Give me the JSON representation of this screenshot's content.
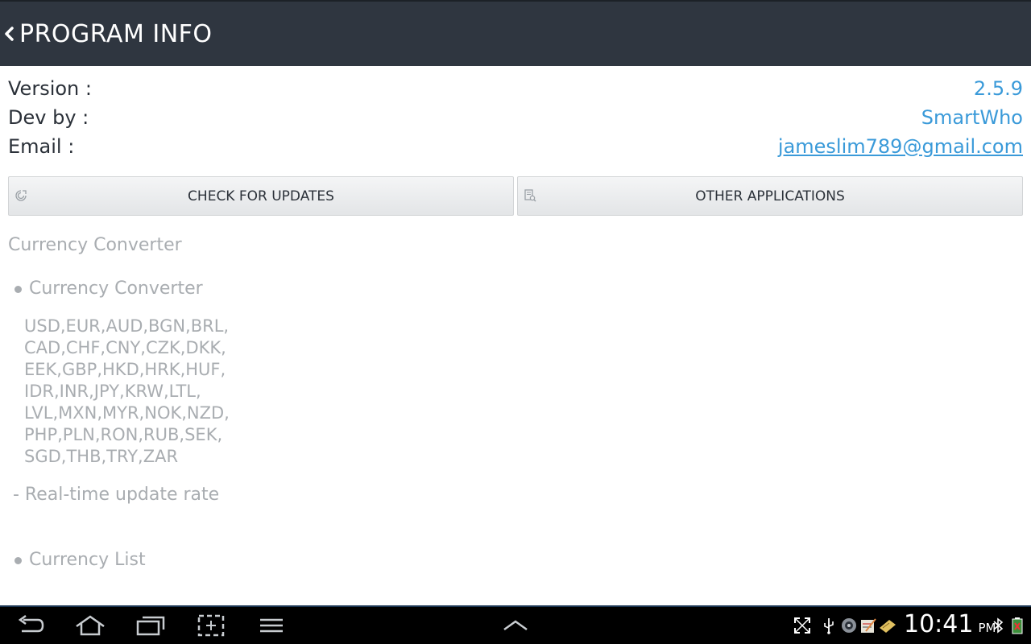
{
  "header": {
    "title": "PROGRAM INFO"
  },
  "info": {
    "version_label": "Version :",
    "version_value": "2.5.9",
    "dev_label": "Dev by :",
    "dev_value": "SmartWho",
    "email_label": "Email :",
    "email_value": "jameslim789@gmail.com"
  },
  "buttons": {
    "check_updates": "CHECK FOR UPDATES",
    "other_apps": "OTHER APPLICATIONS"
  },
  "description": {
    "heading": "Currency Converter",
    "bullet1": "Currency Converter",
    "codes": [
      "USD,EUR,AUD,BGN,BRL,",
      "CAD,CHF,CNY,CZK,DKK,",
      "EEK,GBP,HKD,HRK,HUF,",
      "IDR,INR,JPY,KRW,LTL,",
      "LVL,MXN,MYR,NOK,NZD,",
      "PHP,PLN,RON,RUB,SEK,",
      "SGD,THB,TRY,ZAR"
    ],
    "feature": "- Real-time update rate",
    "bullet2": "Currency List"
  },
  "status_bar": {
    "time": "10:41",
    "ampm": "PM"
  },
  "icons": {
    "back": "chevron-left-icon",
    "update": "refresh-icon",
    "apps": "search-doc-icon",
    "nav": [
      "back-icon",
      "home-icon",
      "recent-apps-icon",
      "screenshot-icon",
      "menu-icon",
      "chevron-up-icon"
    ],
    "status": [
      "fullscreen-icon",
      "usb-icon",
      "camera-icon",
      "notes-icon",
      "memo-icon",
      "bluetooth-icon",
      "battery-icon"
    ]
  },
  "colors": {
    "actionbar": "#2f3640",
    "accent": "#3a9ad9",
    "muted_text": "#a9adb1"
  }
}
